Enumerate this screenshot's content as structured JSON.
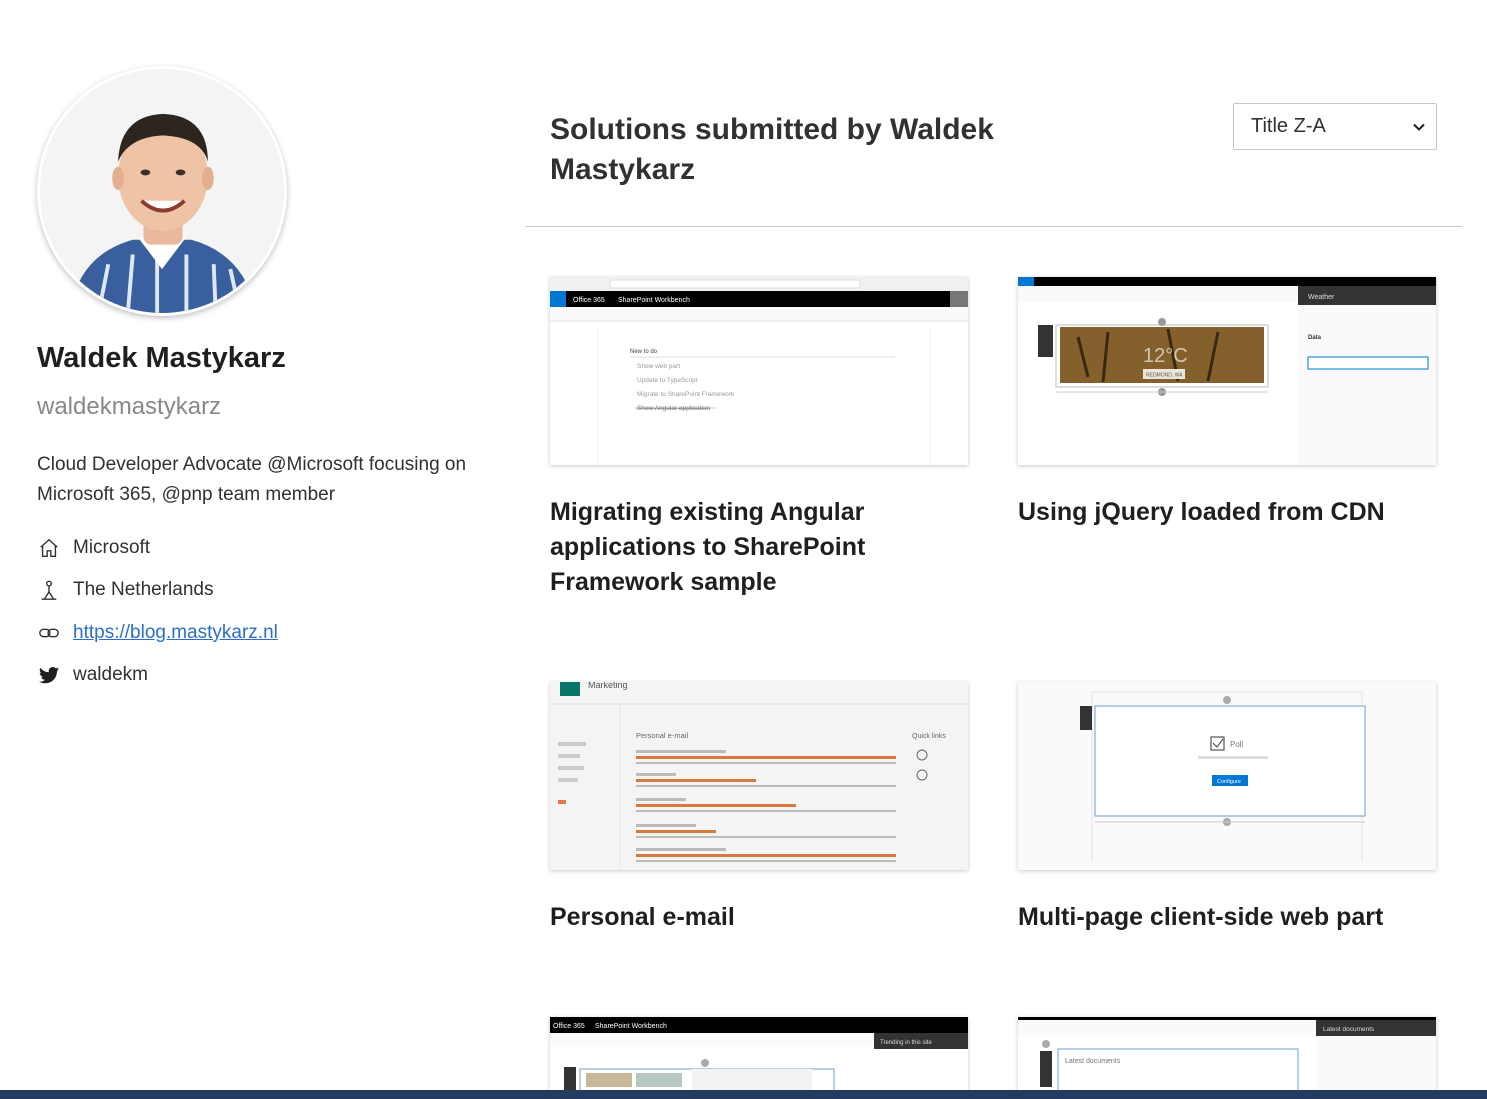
{
  "profile": {
    "name": "Waldek Mastykarz",
    "handle": "waldekmastykarz",
    "bio": "Cloud Developer Advocate @Microsoft focusing on Microsoft 365, @pnp team member",
    "company": "Microsoft",
    "location": "The Netherlands",
    "website": "https://blog.mastykarz.nl",
    "twitter": "waldekm",
    "icons": {
      "company": "home-icon",
      "location": "person-pin-icon",
      "website": "link-icon",
      "twitter": "twitter-icon"
    }
  },
  "main": {
    "heading": "Solutions submitted by Waldek Mastykarz",
    "sort": {
      "selected": "Title Z-A"
    },
    "cards": [
      {
        "title": "Migrating existing Angular applications to SharePoint Framework sample"
      },
      {
        "title": "Using jQuery loaded from CDN"
      },
      {
        "title": "Personal e-mail"
      },
      {
        "title": "Multi-page client-side web part"
      },
      {
        "title": ""
      },
      {
        "title": ""
      }
    ]
  },
  "thumbs": {
    "workbench": "Office 365",
    "workbench_sub": "SharePoint Workbench",
    "todo_header": "New to do",
    "todo_items": [
      "Show web part",
      "Update to TypeScript",
      "Migrate to SharePoint Framework",
      "Show Angular application"
    ],
    "weather_panel": "Weather",
    "weather_data": "Data",
    "weather_city": "REDMOND, WA",
    "weather_temp": "12°C",
    "mail_site": "Marketing",
    "mail_title": "Personal e-mail",
    "mail_quick": "Quick links",
    "poll_label": "Poll",
    "poll_button": "Configure",
    "trending": "Trending in this site",
    "latest_docs": "Latest documents"
  },
  "colors": {
    "accent": "#0078d4",
    "link": "#2b70c4",
    "footer": "#243a5e"
  }
}
